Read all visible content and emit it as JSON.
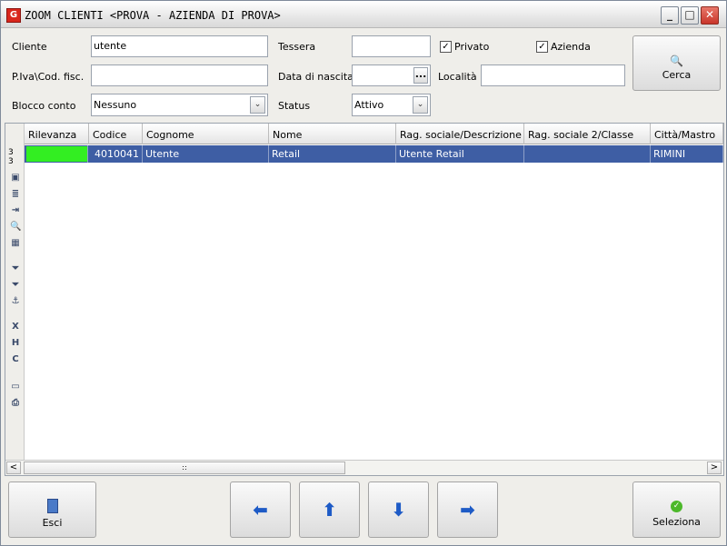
{
  "window": {
    "title": "ZOOM CLIENTI <PROVA - AZIENDA DI PROVA>",
    "app_icon_glyph": "G",
    "minimize_glyph": "_",
    "maximize_glyph": "□",
    "close_glyph": "✕"
  },
  "filters": {
    "cliente_label": "Cliente",
    "cliente_value": "utente",
    "piva_label": "P.Iva\\Cod. fisc.",
    "piva_value": "",
    "blocco_label": "Blocco conto",
    "blocco_value": "Nessuno",
    "tessera_label": "Tessera",
    "tessera_value": "",
    "nascita_label": "Data di nascita",
    "nascita_value": "",
    "nascita_button": "...",
    "status_label": "Status",
    "status_value": "Attivo",
    "privato_label": "Privato",
    "privato_checked": true,
    "azienda_label": "Azienda",
    "azienda_checked": true,
    "localita_label": "Località",
    "localita_value": "",
    "check_glyph": "✓",
    "dropdown_glyph": "⌄"
  },
  "search_button": {
    "label": "Cerca",
    "icon": "magnifier-icon",
    "glyph": "🔍"
  },
  "grid": {
    "row_count_label": "3\n3",
    "columns": [
      "Rilevanza",
      "Codice",
      "Cognome",
      "Nome",
      "Rag. sociale/Descrizione",
      "Rag. sociale 2/Classe",
      "Città/Mastro"
    ],
    "rows": [
      {
        "rilevanza_color": "#33ee22",
        "codice": "4010041",
        "cognome": "Utente",
        "nome": "Retail",
        "rag_sociale": "Utente Retail",
        "rag_sociale2": "",
        "citta": "RIMINI"
      }
    ],
    "selected_row_color": "#3e5ea4",
    "scroll_left": "<",
    "scroll_right": ">",
    "scroll_thumb": "::"
  },
  "toolbar_icons": {
    "t1": "▣",
    "t2": "≣",
    "t3": "⇥",
    "t4": "🔍",
    "t5": "▦",
    "t6": "⏷",
    "t7": "⏷",
    "t8": "⚓",
    "t9": "X",
    "t10": "H",
    "t11": "C",
    "t12": "▭",
    "t13": "⎙"
  },
  "bottom": {
    "esci_label": "Esci",
    "esci_icon": "exit-door-icon",
    "seleziona_label": "Seleziona",
    "seleziona_icon": "check-circle-icon",
    "nav": {
      "left": "⬅",
      "up": "⬆",
      "down": "⬇",
      "right": "➡"
    }
  }
}
